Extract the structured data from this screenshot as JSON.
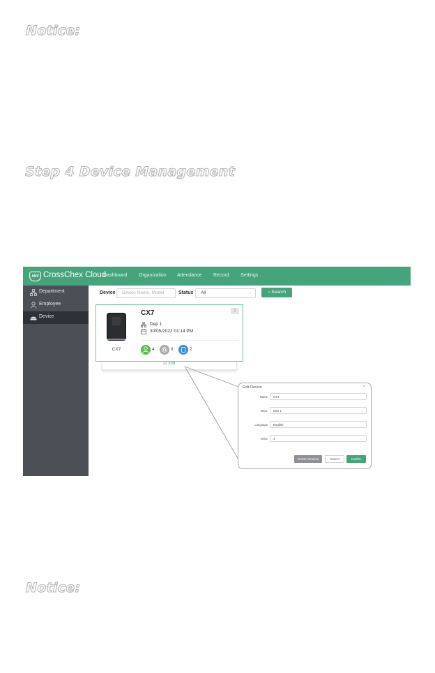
{
  "headings": {
    "notice_top": "Notice:",
    "step4": "Step 4 Device Management",
    "notice_bottom": "Notice:"
  },
  "app": {
    "logo_text": "ANV",
    "brand": "CrossChex Cloud",
    "nav": [
      "Dashboard",
      "Organization",
      "Attendance",
      "Record",
      "Settings"
    ],
    "brand_color": "#45a47b",
    "sidebar_color": "#4c4f56"
  },
  "sidebar": {
    "items": [
      {
        "label": "Department",
        "icon": "department-icon"
      },
      {
        "label": "Employee",
        "icon": "employee-icon"
      },
      {
        "label": "Device",
        "icon": "device-icon",
        "active": true
      }
    ]
  },
  "filters": {
    "device_label": "Device",
    "device_placeholder": "Device Name, Model",
    "status_label": "Status",
    "status_value": "All",
    "search_label": "Search"
  },
  "device_card": {
    "name": "CX7",
    "model": "CX7",
    "department": "Dep 1",
    "datetime": "30/05/2022 01:14 PM",
    "user_count": "4",
    "fingerprint_count": "0",
    "card_count": "2",
    "menu_glyph": "⋮",
    "edit_label": "Edit"
  },
  "edit_dialog": {
    "title": "Edit Device",
    "close_glyph": "×",
    "fields": [
      {
        "label": "Name",
        "value": "CX7"
      },
      {
        "label": "Dept.",
        "value": "Dep 1"
      },
      {
        "label": "Language",
        "value": "English"
      },
      {
        "label": "Voice",
        "value": "4"
      }
    ],
    "delete_label": "Delete Terminal",
    "cancel_label": "Cancel",
    "confirm_label": "Confirm"
  }
}
